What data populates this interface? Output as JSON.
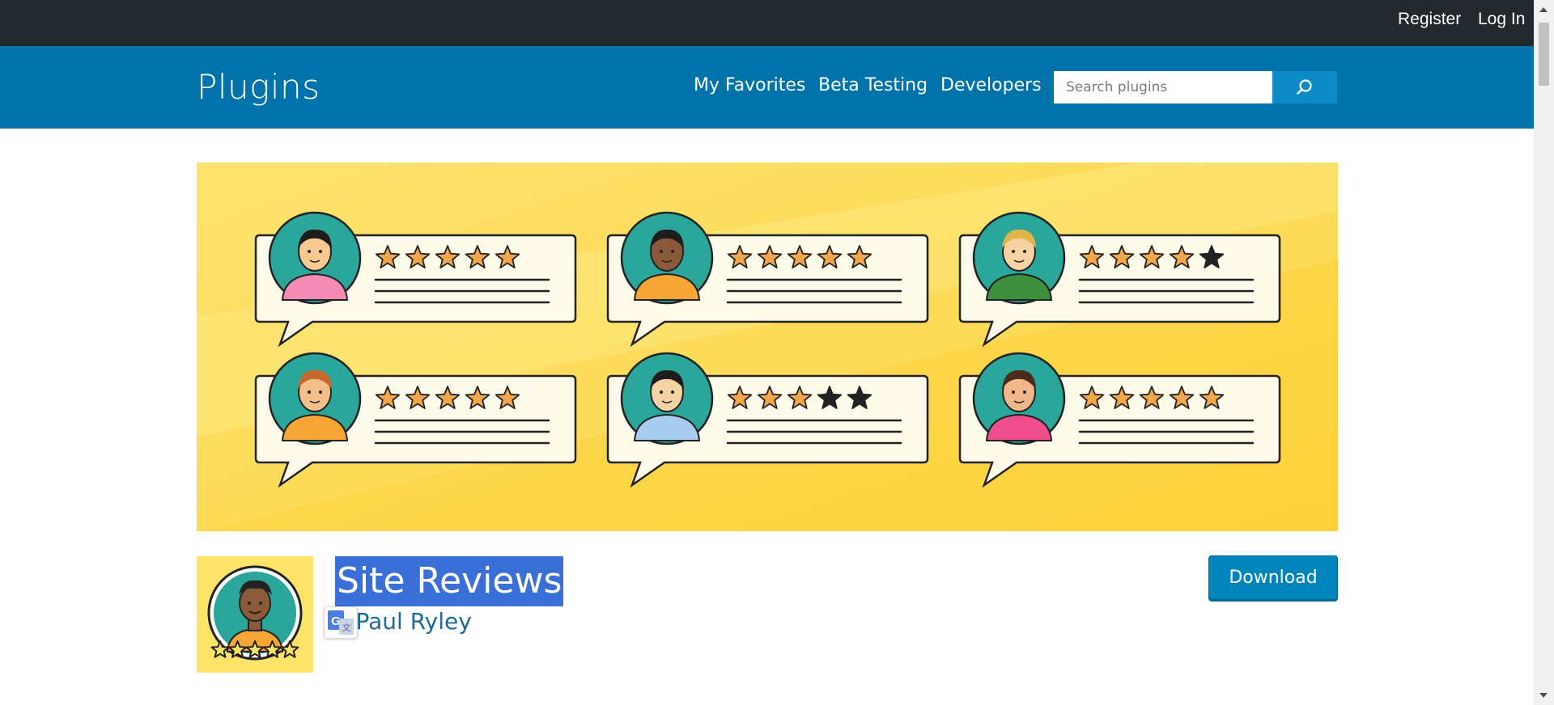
{
  "topbar": {
    "register_label": "Register",
    "login_label": "Log In"
  },
  "header": {
    "site_title": "Plugins",
    "nav": [
      "My Favorites",
      "Beta Testing",
      "Developers"
    ],
    "search_placeholder": "Search plugins",
    "search_icon": "search-icon"
  },
  "banner": {
    "description": "illustration",
    "reviews": [
      {
        "avatar": "woman-pink-shirt",
        "stars_filled": 5,
        "stars_total": 5
      },
      {
        "avatar": "man-orange-shirt",
        "stars_filled": 5,
        "stars_total": 5
      },
      {
        "avatar": "man-green-sweater",
        "stars_filled": 4,
        "stars_total": 5
      },
      {
        "avatar": "boy-red-cap",
        "stars_filled": 5,
        "stars_total": 5
      },
      {
        "avatar": "man-glasses",
        "stars_filled": 3,
        "stars_total": 5
      },
      {
        "avatar": "woman-pink-top",
        "stars_filled": 5,
        "stars_total": 5
      }
    ]
  },
  "plugin": {
    "title": "Site Reviews",
    "by_prefix": "y",
    "author": "Paul Ryley",
    "download_label": "Download"
  },
  "colors": {
    "topbar": "#23282d",
    "header": "#0073aa",
    "banner_bg": "#fde468",
    "star_filled": "#f2a74b",
    "star_empty": "#222222",
    "avatar_circle": "#2aa69a",
    "selection": "#3a6fd8",
    "download_button": "#0085ba"
  }
}
